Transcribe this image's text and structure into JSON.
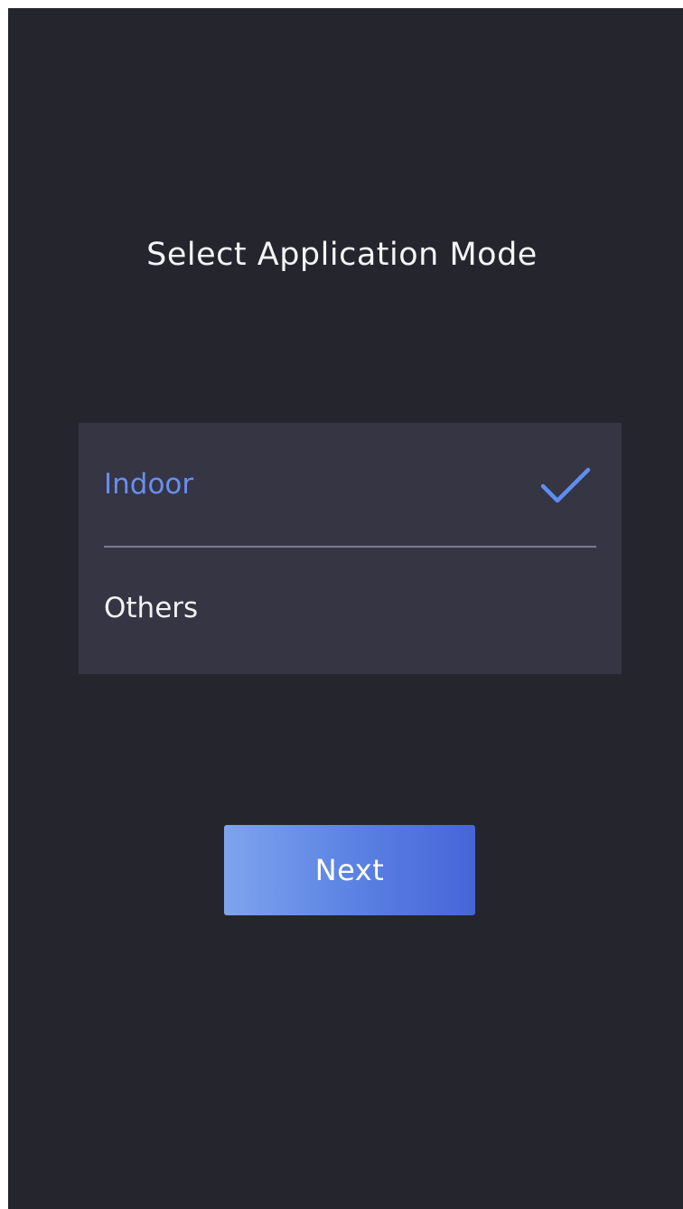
{
  "page": {
    "title": "Select Application Mode"
  },
  "modes": {
    "items": [
      {
        "label": "Indoor",
        "selected": true
      },
      {
        "label": "Others",
        "selected": false
      }
    ]
  },
  "actions": {
    "next_label": "Next"
  },
  "colors": {
    "background": "#25252d",
    "panel": "#353543",
    "accent": "#6a8ef0",
    "text": "#f2f2f4"
  },
  "icons": {
    "selected_indicator": "checkmark-icon"
  }
}
